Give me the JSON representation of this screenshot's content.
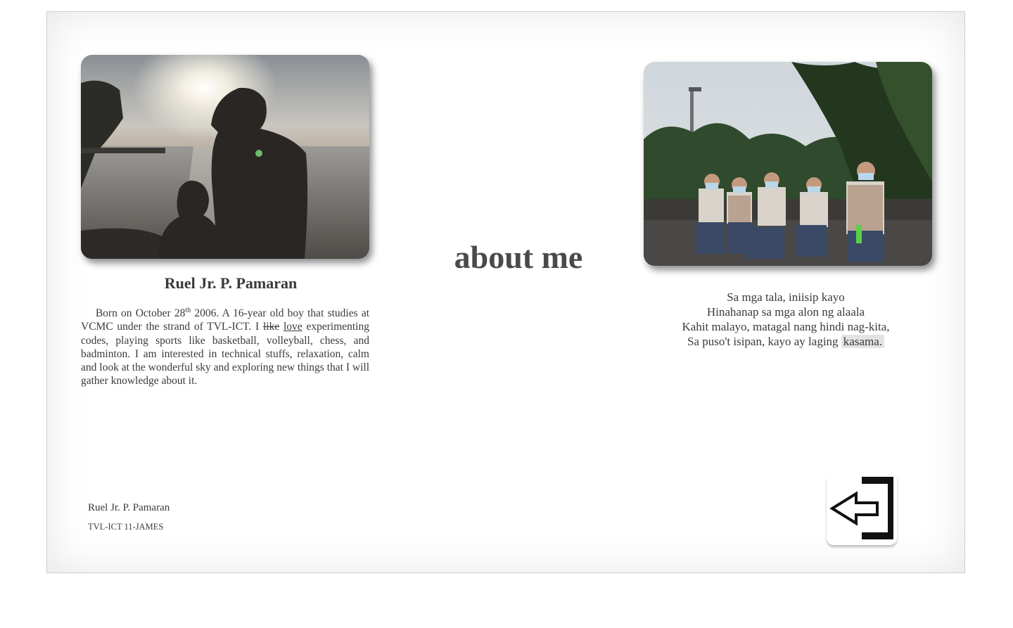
{
  "page": {
    "title": "about me"
  },
  "profile": {
    "name_heading": "Ruel Jr. P. Pamaran",
    "bio": {
      "part1": "Born on October 28",
      "sup": "th",
      "part2": " 2006. A 16-year old boy that studies at VCMC under the strand of TVL-ICT. I ",
      "struck": "like",
      "underlined": "love",
      "part3": " experimenting codes, playing sports like basketball, volleyball, chess, and badminton. I am interested in technical stuffs, relaxation, calm and look at the wonderful sky and exploring new things that I will gather knowledge about it."
    }
  },
  "poem": {
    "line1": "Sa mga tala, iniisip kayo",
    "line2": "Hinahanap sa mga alon ng alaala",
    "line3": "Kahit malayo, matagal nang hindi nag-kita,",
    "line4_text": "Sa puso't isipan, kayo ay laging ",
    "line4_highlight": "kasama."
  },
  "footer": {
    "name": "Ruel Jr. P. Pamaran",
    "class": "TVL-ICT 11-JAMES"
  },
  "icons": {
    "exit": "exit-door-icon"
  },
  "colors": {
    "text": "#3a3a3a",
    "title": "#4a4a4a",
    "highlight": "#e3e3e3"
  }
}
